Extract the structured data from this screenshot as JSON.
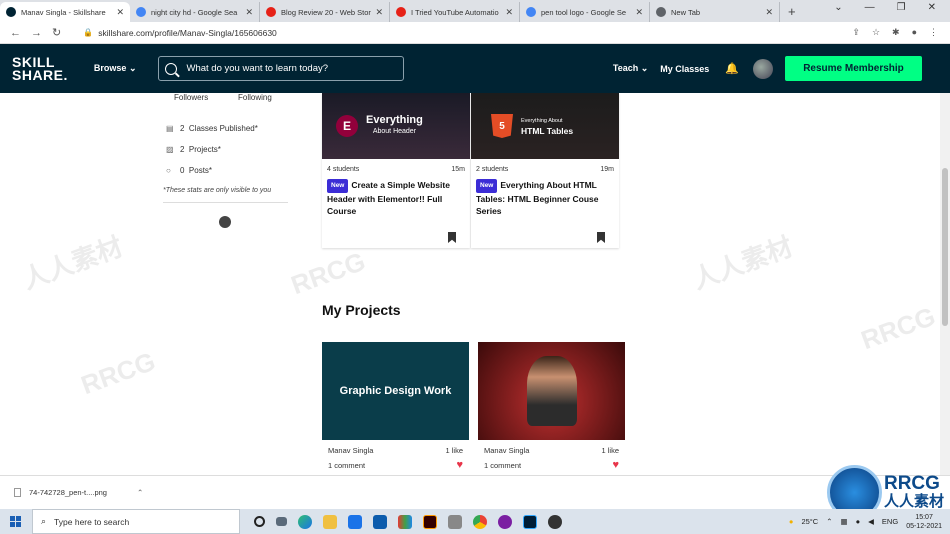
{
  "browser": {
    "tabs": [
      {
        "title": "Manav Singla - Skillshare",
        "active": true,
        "fav_color": "#002333"
      },
      {
        "title": "night city hd - Google Sea",
        "active": false,
        "fav_color": "#4285f4"
      },
      {
        "title": "Blog Review 20 - Web Stor",
        "active": false,
        "fav_color": "#e62117"
      },
      {
        "title": "I Tried YouTube Automatio",
        "active": false,
        "fav_color": "#e62117"
      },
      {
        "title": "pen tool logo - Google Se",
        "active": false,
        "fav_color": "#4285f4"
      },
      {
        "title": "New Tab",
        "active": false,
        "fav_color": "#5f6368"
      }
    ],
    "url": "skillshare.com/profile/Manav-Singla/165606630"
  },
  "header": {
    "logo_line1": "SKILL",
    "logo_line2": "SHARE.",
    "browse_label": "Browse",
    "search_placeholder": "What do you want to learn today?",
    "teach_label": "Teach",
    "my_classes_label": "My Classes",
    "resume_label": "Resume Membership"
  },
  "sidebar": {
    "followers_label": "Followers",
    "following_label": "Following",
    "stats": [
      {
        "count": "2",
        "label": "Classes Published*"
      },
      {
        "count": "2",
        "label": "Projects*"
      },
      {
        "count": "0",
        "label": "Posts*"
      }
    ],
    "note": "*These stats are only visible to you"
  },
  "classes": [
    {
      "image_title": "Everything",
      "image_sub": "About Header",
      "students": "4 students",
      "duration": "15m",
      "badge": "New",
      "title": "Create a Simple Website Header with Elementor!! Full Course"
    },
    {
      "image_title": "Everything About",
      "image_sub": "HTML Tables",
      "students": "2 students",
      "duration": "19m",
      "badge": "New",
      "title": "Everything About HTML Tables: HTML Beginner Couse Series"
    }
  ],
  "projects_heading": "My Projects",
  "projects": [
    {
      "image_text": "Graphic Design Work",
      "author": "Manav Singla",
      "likes": "1 like",
      "comments": "1 comment",
      "bg": "#0a3d4a"
    },
    {
      "image_text": "",
      "author": "Manav Singla",
      "likes": "1 like",
      "comments": "1 comment",
      "bg": "#8a1a1a"
    }
  ],
  "download": {
    "filename": "74-742728_pen-t....png"
  },
  "taskbar": {
    "search_placeholder": "Type here to search",
    "temperature": "25°C",
    "language": "ENG",
    "time": "15:07",
    "date": "05-12-2021"
  },
  "watermark": {
    "brand": "RRCG",
    "cn": "人人素材"
  }
}
